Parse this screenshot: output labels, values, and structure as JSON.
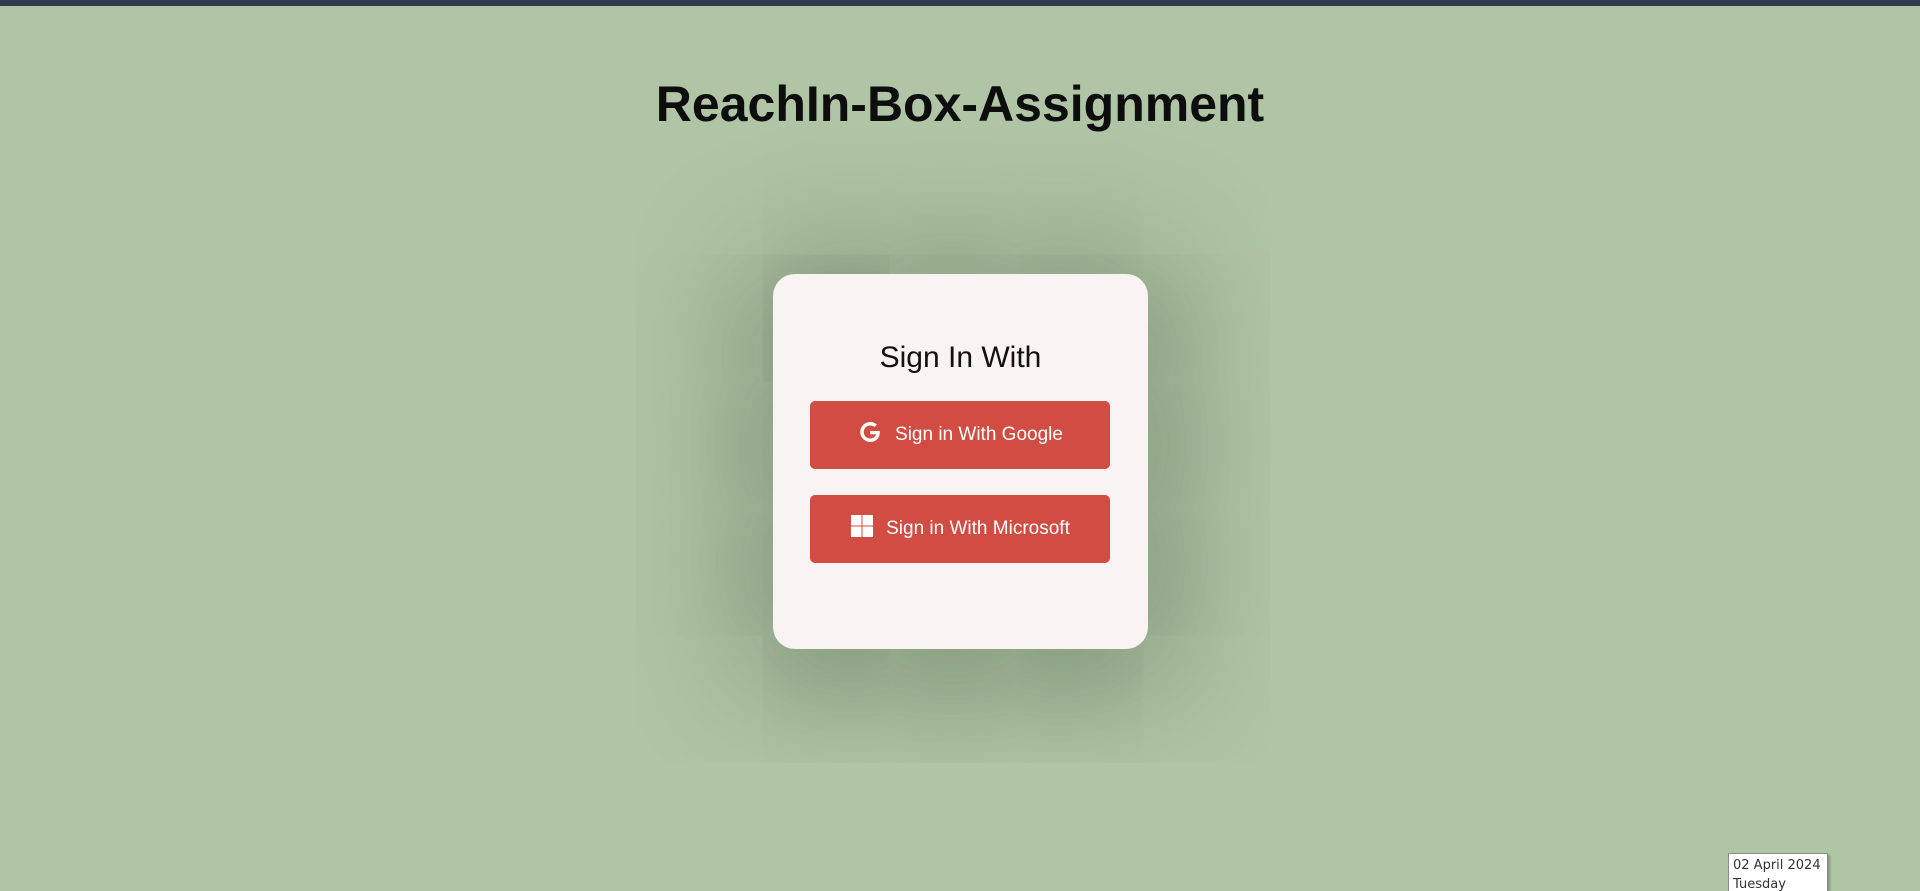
{
  "page": {
    "title": "ReachIn-Box-Assignment",
    "background_color": "#afc5a5",
    "top_bar_color": "#2f3a4a"
  },
  "signin_card": {
    "heading": "Sign In With",
    "background_color": "#f9f3f3",
    "buttons": [
      {
        "label": "Sign in With Google",
        "icon": "google-icon",
        "color": "#d14c42"
      },
      {
        "label": "Sign in With Microsoft",
        "icon": "windows-icon",
        "color": "#d14c42"
      }
    ]
  },
  "date_tooltip": {
    "date": "02 April 2024",
    "weekday": "Tuesday"
  }
}
